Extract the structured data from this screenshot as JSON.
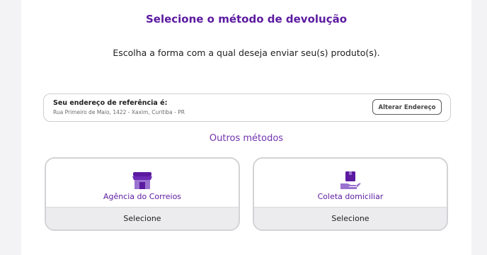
{
  "header": {
    "title": "Selecione o método de devolução",
    "subtitle": "Escolha a forma com a qual deseja enviar seu(s) produto(s)."
  },
  "address": {
    "title": "Seu endereço de referência é:",
    "line": "Rua Primeiro de Maio, 1422 - Xaxim, Curitiba - PR",
    "change_label": "Alterar Endereço"
  },
  "other_methods": {
    "heading": "Outros métodos",
    "options": [
      {
        "label": "Agência do Correios",
        "action": "Selecione",
        "icon": "storefront-icon"
      },
      {
        "label": "Coleta domiciliar",
        "action": "Selecione",
        "icon": "package-hand-icon"
      }
    ]
  },
  "colors": {
    "accent": "#5b1aa0",
    "accent_light": "#9a72d0",
    "footer_bg": "#ececef"
  }
}
